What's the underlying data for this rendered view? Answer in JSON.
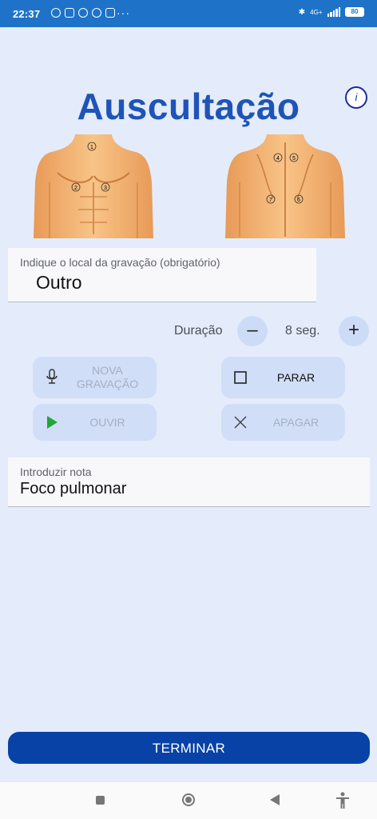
{
  "status_bar": {
    "time": "22:37",
    "network": "4G+",
    "battery": "80"
  },
  "header": {
    "title": "Auscultação",
    "info_label": "i"
  },
  "front_points": [
    "1",
    "2",
    "3"
  ],
  "back_points": [
    "4",
    "5",
    "6",
    "7"
  ],
  "location": {
    "label": "Indique o local da gravação (obrigatório)",
    "value": "Outro"
  },
  "duration": {
    "label": "Duração",
    "decrease_label": "–",
    "increase_label": "+",
    "value": "8 seg."
  },
  "actions": {
    "new_recording": "NOVA GRAVAÇÃO",
    "stop": "PARAR",
    "listen": "OUVIR",
    "delete": "APAGAR"
  },
  "note": {
    "label": "Introduzir nota",
    "value": "Foco pulmonar"
  },
  "finish_label": "TERMINAR",
  "colors": {
    "primary": "#1f54b7",
    "button": "#0842a6",
    "background": "#e4ecfb",
    "play": "#22a63a"
  },
  "icons": {
    "microphone": "microphone-icon",
    "stop": "stop-square-icon",
    "play": "play-icon",
    "delete": "close-x-icon"
  }
}
